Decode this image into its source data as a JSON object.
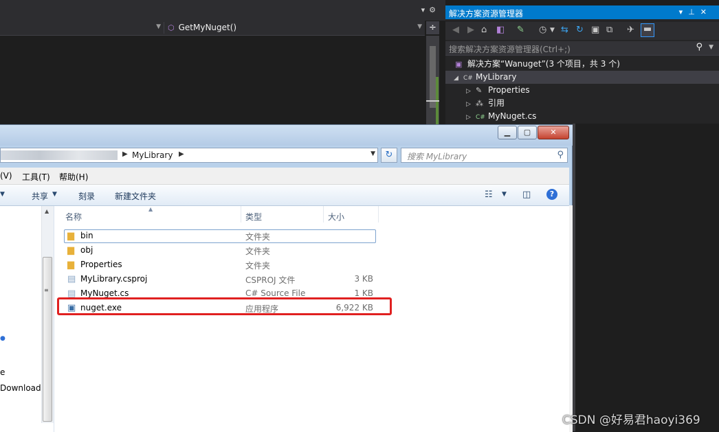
{
  "vs": {
    "navbar": {
      "method": "GetMyNuget()"
    },
    "split_glyph": "÷"
  },
  "solution_explorer": {
    "title": "解决方案资源管理器",
    "search_placeholder": "搜索解决方案资源管理器(Ctrl+;)",
    "tree": [
      {
        "label": "解决方案“Wanuget”(3 个项目，共 3 个)",
        "icon": "solution-icon"
      },
      {
        "label": "MyLibrary",
        "icon": "csharp-project-icon"
      },
      {
        "label": "Properties",
        "icon": "wrench-icon"
      },
      {
        "label": "引用",
        "icon": "references-icon"
      },
      {
        "label": "MyNuget.cs",
        "icon": "csharp-file-icon"
      }
    ]
  },
  "explorer": {
    "address": {
      "current": "MyLibrary"
    },
    "search_placeholder": "搜索 MyLibrary",
    "menu": [
      "(V)",
      "工具(T)",
      "帮助(H)"
    ],
    "commands": [
      "共享",
      "刻录",
      "新建文件夹"
    ],
    "columns": {
      "name": "名称",
      "type": "类型",
      "size": "大小"
    },
    "files": [
      {
        "name": "bin",
        "type": "文件夹",
        "size": "",
        "icon": "folder-icon"
      },
      {
        "name": "obj",
        "type": "文件夹",
        "size": "",
        "icon": "folder-icon"
      },
      {
        "name": "Properties",
        "type": "文件夹",
        "size": "",
        "icon": "folder-icon"
      },
      {
        "name": "MyLibrary.csproj",
        "type": "CSPROJ 文件",
        "size": "3 KB",
        "icon": "document-icon"
      },
      {
        "name": "MyNuget.cs",
        "type": "C# Source File",
        "size": "1 KB",
        "icon": "document-icon"
      },
      {
        "name": "nuget.exe",
        "type": "应用程序",
        "size": "6,922 KB",
        "icon": "exe-icon"
      }
    ],
    "nav_pane": [
      "e",
      "Download"
    ]
  },
  "watermark": "CSDN @好易君haoyi369",
  "colors": {
    "vs_accent": "#007acc",
    "highlight": "#e02020",
    "vs_background": "#1e1e1e"
  }
}
